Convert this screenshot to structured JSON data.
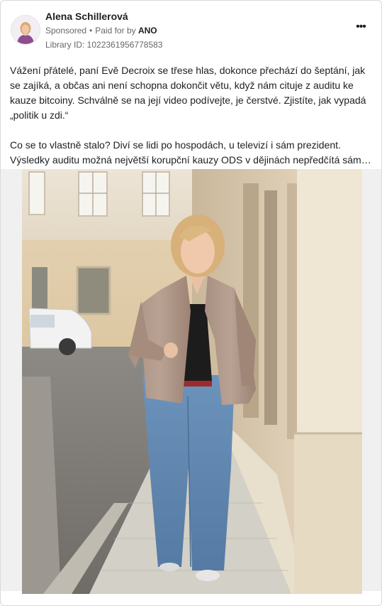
{
  "post": {
    "author": "Alena Schillerová",
    "sponsored_label": "Sponsored",
    "separator": "•",
    "paid_for_by_label": "Paid for by",
    "payer": "ANO",
    "library_id": "Library ID: 1022361956778583",
    "more_icon": "more-horizontal-icon",
    "more_glyph": "•••",
    "paragraphs": [
      "Vážení přátelé, paní Evě Decroix se třese hlas, dokonce přechází do šeptání, jak se zajíká, a občas ani není schopna dokončit větu, když nám cituje z auditu ke kauze bitcoiny. Schválně se na její video podívejte, je čerstvé. Zjistíte, jak vypadá „politik u zdi.“",
      "Co se to vlastně stalo? Diví se lidi po hospodách, u televizí i sám prezident. Výsledky auditu možná největší korupční kauzy ODS v dějinách nepředčítá sám…"
    ]
  },
  "colors": {
    "text": "#1c1e21",
    "secondary_text": "#65676b",
    "border": "#d9d9d9",
    "media_background": "#f0f0f0"
  }
}
